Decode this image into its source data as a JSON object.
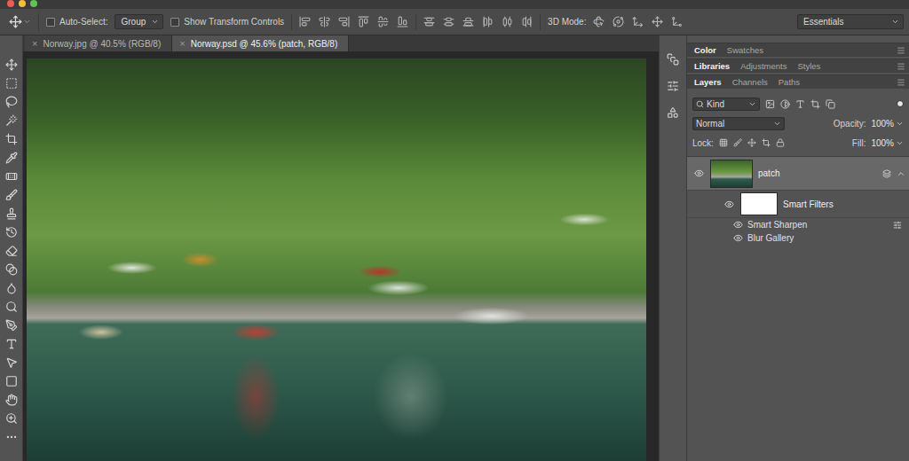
{
  "options_bar": {
    "auto_select": {
      "label": "Auto-Select:",
      "checked": false
    },
    "target": "Group",
    "transform_controls": {
      "label": "Show Transform Controls",
      "checked": false
    },
    "mode_3d_label": "3D Mode:",
    "workspace": "Essentials"
  },
  "document_tabs": [
    {
      "label": "Norway.jpg @ 40.5% (RGB/8)",
      "close": "×",
      "selected": false
    },
    {
      "label": "Norway.psd @ 45.6% (patch, RGB/8)",
      "close": "×",
      "selected": true
    }
  ],
  "panel_groups": [
    {
      "tabs": [
        {
          "label": "Color",
          "selected": true
        },
        {
          "label": "Swatches",
          "selected": false
        }
      ]
    },
    {
      "tabs": [
        {
          "label": "Libraries",
          "selected": true
        },
        {
          "label": "Adjustments",
          "selected": false
        },
        {
          "label": "Styles",
          "selected": false
        }
      ]
    },
    {
      "tabs": [
        {
          "label": "Layers",
          "selected": true
        },
        {
          "label": "Channels",
          "selected": false
        },
        {
          "label": "Paths",
          "selected": false
        }
      ]
    }
  ],
  "layers_panel": {
    "filter_kind": "Kind",
    "filter_enabled": true,
    "blend_mode": "Normal",
    "opacity_label": "Opacity:",
    "opacity": "100%",
    "lock_label": "Lock:",
    "fill_label": "Fill:",
    "fill": "100%",
    "layers": [
      {
        "name": "patch",
        "visible": true,
        "selected": true,
        "expanded": true,
        "smart_filters": {
          "label": "Smart Filters",
          "visible": true,
          "filters": [
            {
              "name": "Smart Sharpen",
              "visible": true
            },
            {
              "name": "Blur Gallery",
              "visible": true
            }
          ]
        }
      }
    ]
  }
}
